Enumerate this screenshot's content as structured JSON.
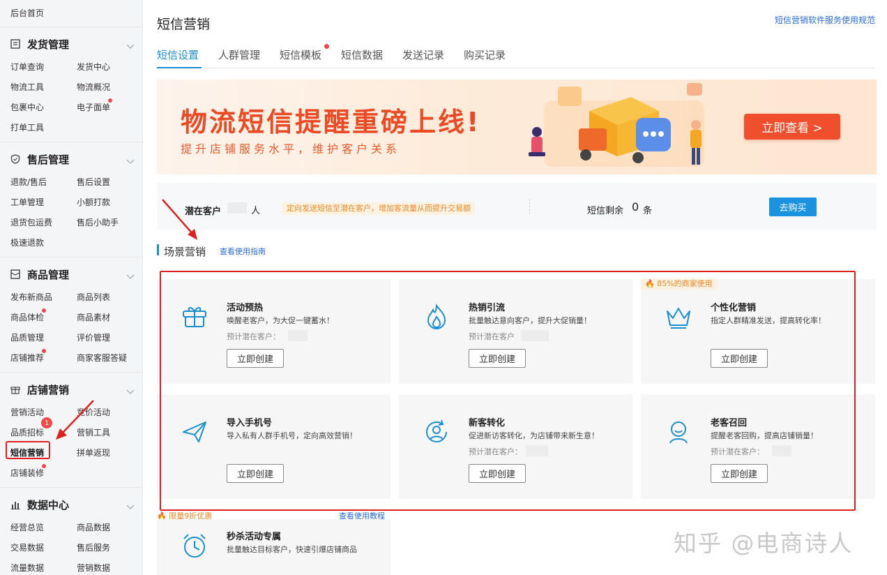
{
  "sidebar": {
    "home": "后台首页",
    "sections": [
      {
        "title": "发货管理",
        "icon": "document-list-icon",
        "items": [
          "订单查询",
          "发货中心",
          "物流工具",
          "物流概况",
          "包裹中心",
          "电子面单",
          "打单工具"
        ]
      },
      {
        "title": "售后管理",
        "icon": "shield-icon",
        "items": [
          "退款/售后",
          "售后设置",
          "工单管理",
          "小额打款",
          "退货包运费",
          "售后小助手",
          "极速退款"
        ]
      },
      {
        "title": "商品管理",
        "icon": "box-icon",
        "items": [
          "发布新商品",
          "商品列表",
          "商品体检",
          "商品素材",
          "品质管理",
          "评价管理",
          "店铺推荐",
          "商家客服答疑"
        ]
      },
      {
        "title": "店铺营销",
        "icon": "gift-icon",
        "items": [
          "营销活动",
          "竞价活动",
          "品质招标",
          "营销工具",
          "短信营销",
          "拼单返现",
          "店铺装修"
        ]
      },
      {
        "title": "数据中心",
        "icon": "bar-chart-icon",
        "items": [
          "经营总览",
          "商品数据",
          "交易数据",
          "售后服务",
          "流量数据",
          "营销数据"
        ]
      }
    ],
    "badge": "1"
  },
  "header": {
    "title": "短信营销",
    "help_link": "短信营销软件服务使用规范"
  },
  "tabs": [
    "短信设置",
    "人群管理",
    "短信模板",
    "短信数据",
    "发送记录",
    "购买记录"
  ],
  "banner": {
    "title": "物流短信提醒重磅上线!",
    "subtitle": "提升店铺服务水平，维护客户关系",
    "button": "立即查看 >"
  },
  "stats": {
    "potential_label": "潜在客户",
    "potential_unit": "人",
    "tip": "定向发送短信至潜在客户，增加客流量从而提升交易额",
    "remain_label": "短信剩余",
    "remain_count": "0",
    "remain_unit": "条",
    "buy_button": "去购买"
  },
  "section": {
    "title": "场景营销",
    "guide_link": "查看使用指南"
  },
  "cards": [
    {
      "title": "活动预热",
      "desc": "唤醒老客户，为大促一键蓄水！",
      "estimate": "预计潜在客户：",
      "button": "立即创建",
      "icon": "gift-box-icon"
    },
    {
      "title": "热销引流",
      "desc": "批量触达意向客户，提升大促销量！",
      "estimate": "预计潜在客户",
      "button": "立即创建",
      "icon": "flame-icon"
    },
    {
      "title": "个性化营销",
      "desc": "指定人群精准发送，提高转化率！",
      "estimate": "",
      "button": "立即创建",
      "icon": "crown-icon"
    },
    {
      "title": "导入手机号",
      "desc": "导入私有人群手机号，定向高效营销！",
      "estimate": "",
      "button": "立即创建",
      "icon": "paper-plane-icon"
    },
    {
      "title": "新客转化",
      "desc": "促进新访客转化，为店铺带来新生意！",
      "estimate": "预计潜在客户：",
      "button": "立即创建",
      "icon": "user-refresh-icon"
    },
    {
      "title": "老客召回",
      "desc": "提醒老客回购，提高店铺销量！",
      "estimate": "预计潜在客户：",
      "button": "立即创建",
      "icon": "customer-icon"
    },
    {
      "title": "秒杀活动专属",
      "desc": "批量触达目标客户，快速引爆店铺商品",
      "estimate": "",
      "button": "",
      "icon": "alarm-clock-icon"
    }
  ],
  "hot_tag": "85%的商家使用",
  "promo_tag": "限量9折优惠",
  "promo_link": "查看使用教程",
  "watermark": "知乎 @电商诗人",
  "colors": {
    "accent": "#1a8fd0",
    "highlight": "#e02020",
    "banner_orange": "#ea4b24",
    "tag_orange": "#e98a27"
  }
}
